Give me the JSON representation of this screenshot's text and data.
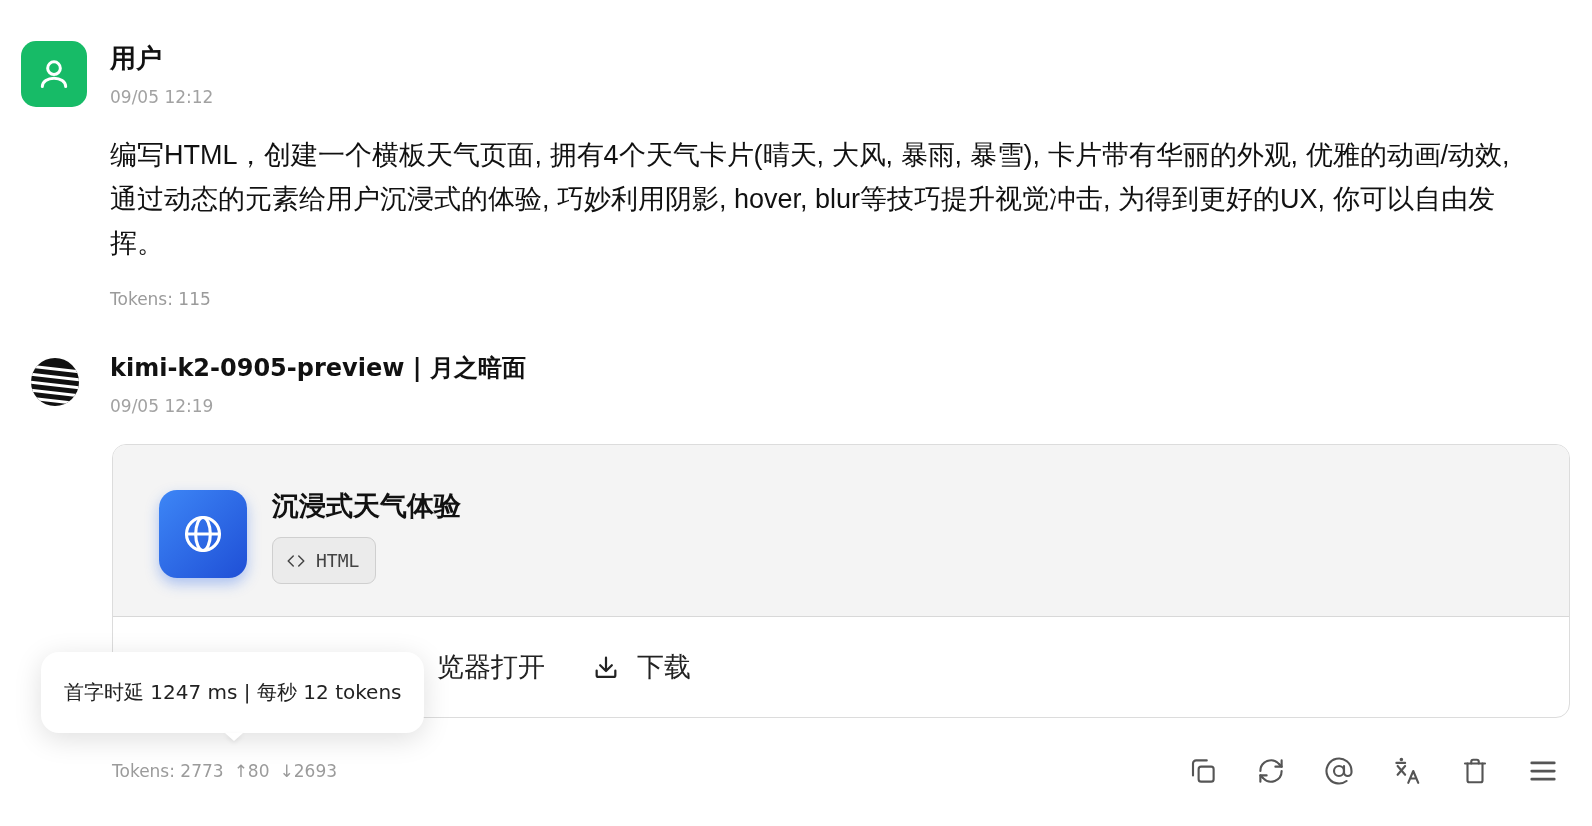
{
  "messages": [
    {
      "kind": "user",
      "author": "用户",
      "time": "09/05 12:12",
      "text": "编写HTML，创建一个横板天气页面, 拥有4个天气卡片(晴天, 大风, 暴雨, 暴雪), 卡片带有华丽的外观, 优雅的动画/动效, 通过动态的元素给用户沉浸式的体验, 巧妙利用阴影, hover, blur等技巧提升视觉冲击, 为得到更好的UX, 你可以自由发挥。",
      "tokens": "Tokens: 115"
    },
    {
      "kind": "assistant",
      "author": "kimi-k2-0905-preview | 月之暗面",
      "time": "09/05 12:19",
      "artifact": {
        "title": "沉浸式天气体验",
        "language": "HTML",
        "actions": [
          {
            "kind": "text",
            "label": "览器打开"
          },
          {
            "kind": "download",
            "label": "下载"
          }
        ]
      },
      "tokens": "Tokens: 2773",
      "tokens_in": "↑80",
      "tokens_out": "↓2693",
      "tooltip": "首字时延 1247 ms | 每秒 12 tokens"
    }
  ]
}
